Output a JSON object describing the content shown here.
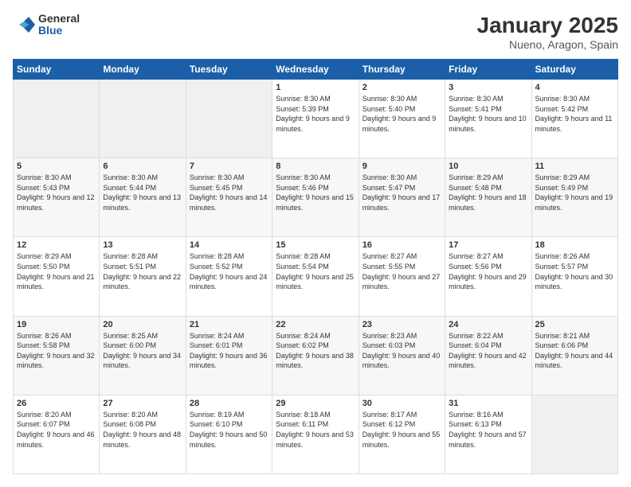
{
  "logo": {
    "general": "General",
    "blue": "Blue"
  },
  "header": {
    "title": "January 2025",
    "subtitle": "Nueno, Aragon, Spain"
  },
  "weekdays": [
    "Sunday",
    "Monday",
    "Tuesday",
    "Wednesday",
    "Thursday",
    "Friday",
    "Saturday"
  ],
  "weeks": [
    [
      {
        "day": "",
        "info": ""
      },
      {
        "day": "",
        "info": ""
      },
      {
        "day": "",
        "info": ""
      },
      {
        "day": "1",
        "info": "Sunrise: 8:30 AM\nSunset: 5:39 PM\nDaylight: 9 hours\nand 9 minutes."
      },
      {
        "day": "2",
        "info": "Sunrise: 8:30 AM\nSunset: 5:40 PM\nDaylight: 9 hours\nand 9 minutes."
      },
      {
        "day": "3",
        "info": "Sunrise: 8:30 AM\nSunset: 5:41 PM\nDaylight: 9 hours\nand 10 minutes."
      },
      {
        "day": "4",
        "info": "Sunrise: 8:30 AM\nSunset: 5:42 PM\nDaylight: 9 hours\nand 11 minutes."
      }
    ],
    [
      {
        "day": "5",
        "info": "Sunrise: 8:30 AM\nSunset: 5:43 PM\nDaylight: 9 hours\nand 12 minutes."
      },
      {
        "day": "6",
        "info": "Sunrise: 8:30 AM\nSunset: 5:44 PM\nDaylight: 9 hours\nand 13 minutes."
      },
      {
        "day": "7",
        "info": "Sunrise: 8:30 AM\nSunset: 5:45 PM\nDaylight: 9 hours\nand 14 minutes."
      },
      {
        "day": "8",
        "info": "Sunrise: 8:30 AM\nSunset: 5:46 PM\nDaylight: 9 hours\nand 15 minutes."
      },
      {
        "day": "9",
        "info": "Sunrise: 8:30 AM\nSunset: 5:47 PM\nDaylight: 9 hours\nand 17 minutes."
      },
      {
        "day": "10",
        "info": "Sunrise: 8:29 AM\nSunset: 5:48 PM\nDaylight: 9 hours\nand 18 minutes."
      },
      {
        "day": "11",
        "info": "Sunrise: 8:29 AM\nSunset: 5:49 PM\nDaylight: 9 hours\nand 19 minutes."
      }
    ],
    [
      {
        "day": "12",
        "info": "Sunrise: 8:29 AM\nSunset: 5:50 PM\nDaylight: 9 hours\nand 21 minutes."
      },
      {
        "day": "13",
        "info": "Sunrise: 8:28 AM\nSunset: 5:51 PM\nDaylight: 9 hours\nand 22 minutes."
      },
      {
        "day": "14",
        "info": "Sunrise: 8:28 AM\nSunset: 5:52 PM\nDaylight: 9 hours\nand 24 minutes."
      },
      {
        "day": "15",
        "info": "Sunrise: 8:28 AM\nSunset: 5:54 PM\nDaylight: 9 hours\nand 25 minutes."
      },
      {
        "day": "16",
        "info": "Sunrise: 8:27 AM\nSunset: 5:55 PM\nDaylight: 9 hours\nand 27 minutes."
      },
      {
        "day": "17",
        "info": "Sunrise: 8:27 AM\nSunset: 5:56 PM\nDaylight: 9 hours\nand 29 minutes."
      },
      {
        "day": "18",
        "info": "Sunrise: 8:26 AM\nSunset: 5:57 PM\nDaylight: 9 hours\nand 30 minutes."
      }
    ],
    [
      {
        "day": "19",
        "info": "Sunrise: 8:26 AM\nSunset: 5:58 PM\nDaylight: 9 hours\nand 32 minutes."
      },
      {
        "day": "20",
        "info": "Sunrise: 8:25 AM\nSunset: 6:00 PM\nDaylight: 9 hours\nand 34 minutes."
      },
      {
        "day": "21",
        "info": "Sunrise: 8:24 AM\nSunset: 6:01 PM\nDaylight: 9 hours\nand 36 minutes."
      },
      {
        "day": "22",
        "info": "Sunrise: 8:24 AM\nSunset: 6:02 PM\nDaylight: 9 hours\nand 38 minutes."
      },
      {
        "day": "23",
        "info": "Sunrise: 8:23 AM\nSunset: 6:03 PM\nDaylight: 9 hours\nand 40 minutes."
      },
      {
        "day": "24",
        "info": "Sunrise: 8:22 AM\nSunset: 6:04 PM\nDaylight: 9 hours\nand 42 minutes."
      },
      {
        "day": "25",
        "info": "Sunrise: 8:21 AM\nSunset: 6:06 PM\nDaylight: 9 hours\nand 44 minutes."
      }
    ],
    [
      {
        "day": "26",
        "info": "Sunrise: 8:20 AM\nSunset: 6:07 PM\nDaylight: 9 hours\nand 46 minutes."
      },
      {
        "day": "27",
        "info": "Sunrise: 8:20 AM\nSunset: 6:08 PM\nDaylight: 9 hours\nand 48 minutes."
      },
      {
        "day": "28",
        "info": "Sunrise: 8:19 AM\nSunset: 6:10 PM\nDaylight: 9 hours\nand 50 minutes."
      },
      {
        "day": "29",
        "info": "Sunrise: 8:18 AM\nSunset: 6:11 PM\nDaylight: 9 hours\nand 53 minutes."
      },
      {
        "day": "30",
        "info": "Sunrise: 8:17 AM\nSunset: 6:12 PM\nDaylight: 9 hours\nand 55 minutes."
      },
      {
        "day": "31",
        "info": "Sunrise: 8:16 AM\nSunset: 6:13 PM\nDaylight: 9 hours\nand 57 minutes."
      },
      {
        "day": "",
        "info": ""
      }
    ]
  ]
}
